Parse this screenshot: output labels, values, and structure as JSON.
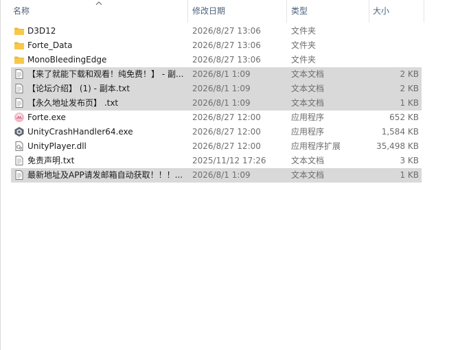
{
  "columns": {
    "name": "名称",
    "date": "修改日期",
    "type": "类型",
    "size": "大小"
  },
  "files": [
    {
      "name": "D3D12",
      "date": "2026/8/27 13:06",
      "type": "文件夹",
      "size": "",
      "icon": "folder-icon",
      "selected": false
    },
    {
      "name": "Forte_Data",
      "date": "2026/8/27 13:06",
      "type": "文件夹",
      "size": "",
      "icon": "folder-icon",
      "selected": false
    },
    {
      "name": "MonoBleedingEdge",
      "date": "2026/8/27 13:06",
      "type": "文件夹",
      "size": "",
      "icon": "folder-icon",
      "selected": false
    },
    {
      "name": "【来了就能下载和观看！纯免费！】 - 副...",
      "date": "2026/8/1 1:09",
      "type": "文本文档",
      "size": "2 KB",
      "icon": "text-document-icon",
      "selected": true
    },
    {
      "name": "【论坛介绍】 (1) - 副本.txt",
      "date": "2026/8/1 1:09",
      "type": "文本文档",
      "size": "2 KB",
      "icon": "text-document-icon",
      "selected": true
    },
    {
      "name": "【永久地址发布页】 .txt",
      "date": "2026/8/1 1:09",
      "type": "文本文档",
      "size": "1 KB",
      "icon": "text-document-icon",
      "selected": true
    },
    {
      "name": "Forte.exe",
      "date": "2026/8/27 12:00",
      "type": "应用程序",
      "size": "652 KB",
      "icon": "forte-app-icon",
      "selected": false
    },
    {
      "name": "UnityCrashHandler64.exe",
      "date": "2026/8/27 12:00",
      "type": "应用程序",
      "size": "1,584 KB",
      "icon": "unity-app-icon",
      "selected": false
    },
    {
      "name": "UnityPlayer.dll",
      "date": "2026/8/27 12:00",
      "type": "应用程序扩展",
      "size": "35,498 KB",
      "icon": "dll-file-icon",
      "selected": false
    },
    {
      "name": "免责声明.txt",
      "date": "2025/11/12 17:26",
      "type": "文本文档",
      "size": "3 KB",
      "icon": "text-document-icon",
      "selected": false
    },
    {
      "name": "最新地址及APP请发邮箱自动获取！！！...",
      "date": "2026/8/1 1:09",
      "type": "文本文档",
      "size": "1 KB",
      "icon": "text-document-icon",
      "selected": true
    }
  ],
  "colors": {
    "selected_row": "#d9d9d9",
    "header_text": "#4c607a",
    "folder": "#f8c84a"
  }
}
